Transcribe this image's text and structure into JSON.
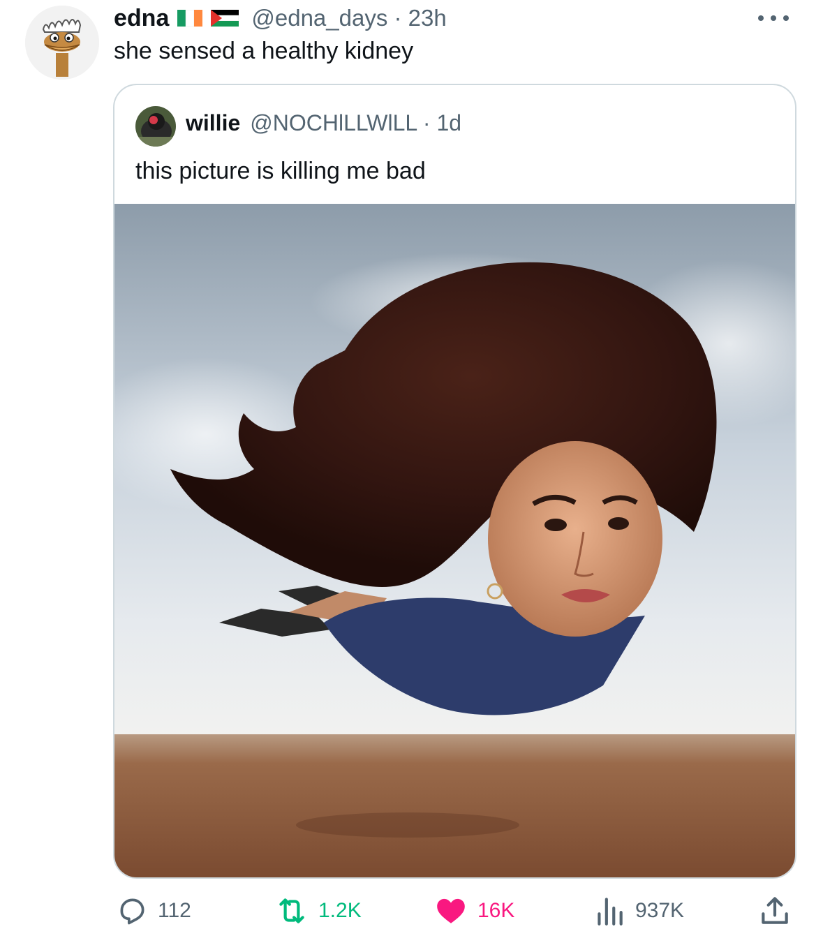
{
  "tweet": {
    "display_name": "edna",
    "flags": [
      "ireland-flag-icon",
      "palestine-flag-icon"
    ],
    "handle_time": "@edna_days · 23h",
    "text": "she sensed a healthy kidney",
    "more_icon": "more-dots-icon"
  },
  "quoted": {
    "display_name": "willie",
    "handle_time": "@NOCHlLLWlLL · 1d",
    "text": "this picture is killing me bad",
    "image": "photo of a flying woman with huge hair over a desert"
  },
  "actions": {
    "reply": {
      "icon": "reply-icon",
      "count": "112"
    },
    "retweet": {
      "icon": "retweet-icon",
      "count": "1.2K",
      "color": "#00ba7c"
    },
    "like": {
      "icon": "heart-icon",
      "count": "16K",
      "color": "#f91880"
    },
    "views": {
      "icon": "views-icon",
      "count": "937K"
    },
    "share": {
      "icon": "share-icon"
    }
  },
  "colors": {
    "text_primary": "#0f1419",
    "text_secondary": "#536471",
    "border": "#cfd9de"
  }
}
